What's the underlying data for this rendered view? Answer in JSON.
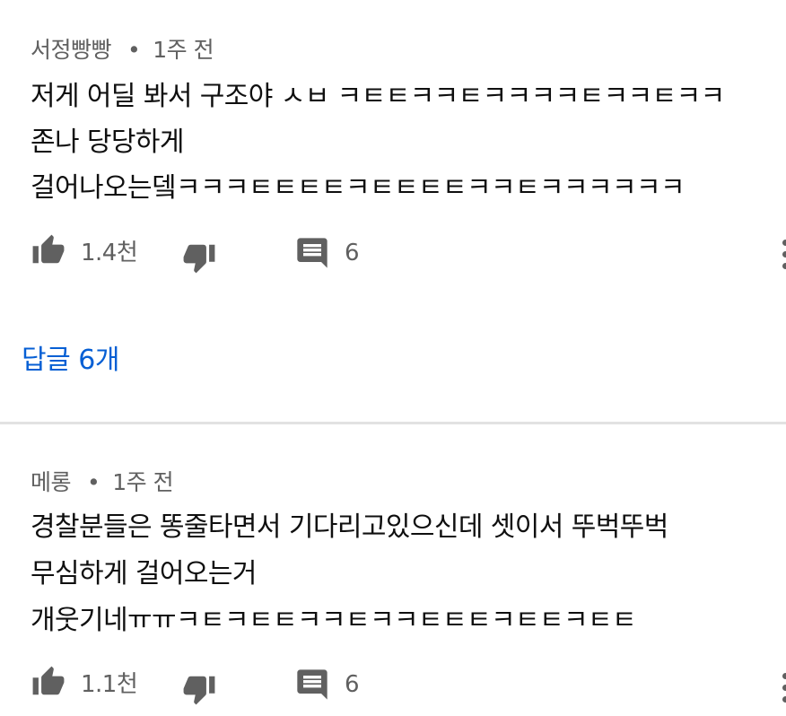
{
  "comments": [
    {
      "author": "서정빵빵",
      "dot": "•",
      "time": "1주 전",
      "lines": [
        "저게 어딜 봐서 구조야 ㅅㅂ ㅋㅌㅌㅋㅋㅌㅋㅋㅋㅋㅌㅋㅋㅌㅋㅋ",
        "존나 당당하게",
        "걸어나오는뎈ㅋㅋㅋㅌㅌㅌㅌㅋㅌㅌㅌㅌㅋㅋㅌㅋㅋㅋㅋㅋㅋ"
      ],
      "likes": "1.4천",
      "reply_count": "6",
      "view_replies": "답글 6개"
    },
    {
      "author": "메롱",
      "dot": "•",
      "time": "1주 전",
      "lines": [
        "경찰분들은 똥줄타면서 기다리고있으신데 셋이서 뚜벅뚜벅",
        "무심하게 걸어오는거",
        "개웃기네ㅠㅠㅋㅌㅋㅌㅌㅋㅋㅌㅋㅋㅌㅌㅌㅋㅌㅌㅋㅌㅌ"
      ],
      "likes": "1.1천",
      "reply_count": "6"
    }
  ],
  "icons": {
    "like": "thumbs-up-icon",
    "dislike": "thumbs-down-icon",
    "reply": "comment-icon",
    "more": "more-vert-icon"
  },
  "colors": {
    "text": "#0f0f0f",
    "secondary": "#606060",
    "link": "#065fd4",
    "divider": "#e2e2e2"
  }
}
